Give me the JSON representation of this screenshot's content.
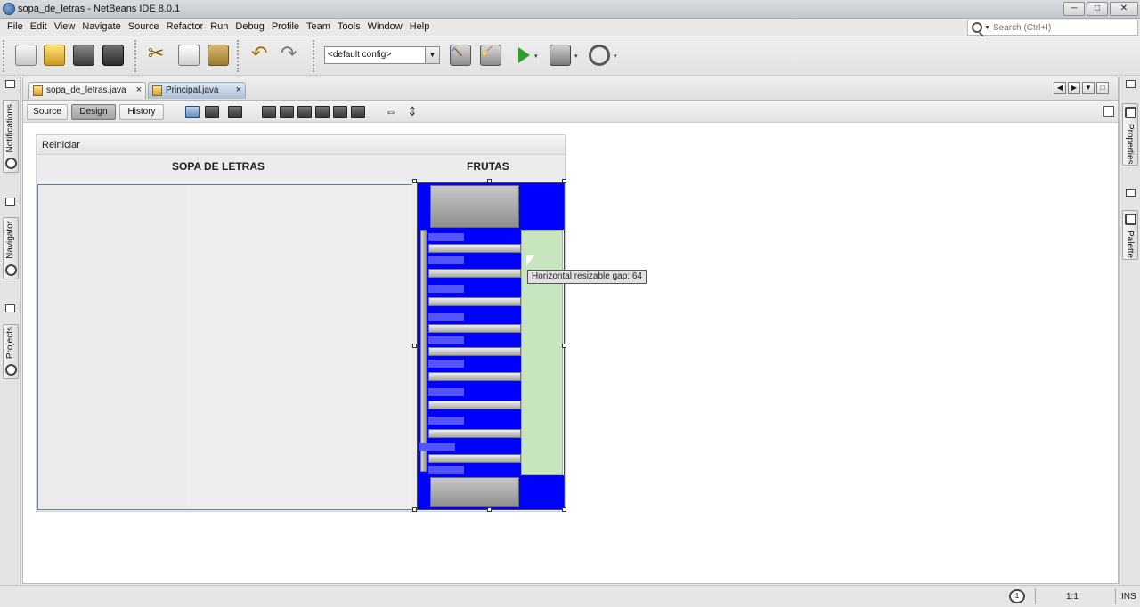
{
  "window": {
    "title": "sopa_de_letras - NetBeans IDE 8.0.1",
    "minimize": "─",
    "maximize": "□",
    "close": "✕"
  },
  "menu": [
    "File",
    "Edit",
    "View",
    "Navigate",
    "Source",
    "Refactor",
    "Run",
    "Debug",
    "Profile",
    "Team",
    "Tools",
    "Window",
    "Help"
  ],
  "search": {
    "placeholder": "Search (Ctrl+I)"
  },
  "toolbar": {
    "config_value": "<default config>",
    "dropdown_arrow": "▼",
    "mini_arrow": "▾"
  },
  "left_side": {
    "tabs": [
      "Notifications",
      "Navigator",
      "Projects"
    ]
  },
  "right_side": {
    "tabs": [
      "Properties",
      "Palette"
    ]
  },
  "editor": {
    "tabs": [
      {
        "label": "sopa_de_letras.java",
        "close": "×"
      },
      {
        "label": "Principal.java",
        "close": "×"
      }
    ],
    "tab_nav": [
      "◀",
      "▶",
      "▼",
      "□"
    ],
    "modes": [
      "Source",
      "Design",
      "History"
    ],
    "active_mode": "Design",
    "arrow_h": "⇔",
    "arrow_v": "⇕"
  },
  "form": {
    "menu_label": "Reiniciar",
    "left_header": "SOPA DE LETRAS",
    "right_header": "FRUTAS"
  },
  "tooltip": "Horizontal resizable gap: 64",
  "status": {
    "notif": "1",
    "position": "1:1",
    "mode": "INS"
  },
  "colors": {
    "accent_blue": "#0000ff",
    "green_gap": "#c7e5bf"
  }
}
